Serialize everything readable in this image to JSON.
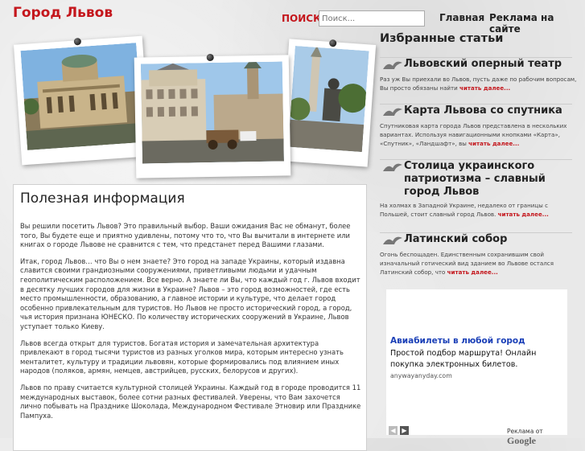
{
  "header": {
    "site_title": "Город Львов",
    "search_label": "ПОИСК",
    "search_placeholder": "Поиск...",
    "nav": [
      "Главная",
      "Реклама на сайте"
    ]
  },
  "content": {
    "title": "Полезная информация",
    "paragraphs": [
      "Вы решили посетить Львов? Это правильный выбор. Ваши ожидания Вас не обманут, более того, Вы будете еще и приятно удивлены, потому что то, что Вы вычитали в интернете или книгах о городе Львове не сравнится с тем, что предстанет перед Вашими глазами.",
      "Итак, город Львов… что Вы о нем знаете? Это город на западе Украины, который издавна славится своими грандиозными сооружениями, приветливыми людьми и удачным геополитическим расположением. Все верно. А знаете ли Вы, что каждый год г. Львов входит в десятку лучших городов для жизни в Украине? Львов – это город возможностей, где есть место промышленности, образованию, а главное истории и культуре, что делает город особенно привлекательным для туристов. Но Львов не просто исторический город, а город, чья история признана ЮНЕСКО. По количеству исторических сооружений в Украине, Львов уступает только Киеву.",
      "Львов всегда открыт для туристов. Богатая история и замечательная архитектура привлекают в город тысячи туристов из разных уголков мира, которым интересно узнать менталитет, культуру и традиции львовян, которые формировались под влиянием иных народов (поляков, армян, немцев, австрийцев, русских, белорусов и других).",
      "Львов по праву считается культурной столицей Украины. Каждый год в городе проводится 11 международных выставок, более сотни разных фестивалей. Уверены, что Вам захочется лично побывать на Празднике Шоколада, Международном Фестивале Этновир или Празднике Пампуха."
    ]
  },
  "sidebar": {
    "title": "Избранные статьи",
    "more_label": "читать далее...",
    "articles": [
      {
        "title": "Львовский оперный театр",
        "text": "Раз уж Вы приехали во Львов, пусть даже по рабочим вопросам, Вы просто обязаны найти"
      },
      {
        "title": "Карта Львова со спутника",
        "text": "Спутниковая карта города Львов представлена в нескольких вариантах. Используя навигационными кнопками «Карта», «Спутник», «Ландшафт», вы"
      },
      {
        "title": "Столица украинского патриотизма – славный город Львов",
        "text": "На холмах в Западной Украине, недалеко от границы с Польшей, стоит славный город Львов."
      },
      {
        "title": "Латинский собор",
        "text": "Огонь беспощаден. Единственным сохранившим свой изначальный готический вид зданием во Львове остался Латинский собор, что"
      }
    ]
  },
  "ad": {
    "title": "Авиабилеты в любой город",
    "text": "Простой подбор маршрута! Онлайн покупка электронных билетов.",
    "url": "anywayanyday.com",
    "by_label": "Реклама от",
    "brand": "Google"
  }
}
